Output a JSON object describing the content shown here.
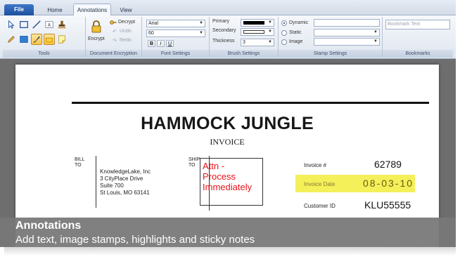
{
  "ribbon": {
    "tabs": [
      "File",
      "Home",
      "Annotations",
      "View"
    ],
    "groups": [
      "Tools",
      "Document Encryption",
      "Font Settings",
      "Brush Settings",
      "Stamp Settings",
      "Bookmarks"
    ],
    "encryption": {
      "encrypt": "Encrypt",
      "decrypt": "Decrypt",
      "undo": "Undo",
      "redo": "Redo"
    },
    "font": {
      "family": "Arial",
      "size": "60",
      "bold": "B",
      "italic": "I",
      "underline": "U"
    },
    "brush": {
      "primary": "Primary",
      "secondary": "Secondary",
      "thickness": "Thickness",
      "thickness_value": "3",
      "primary_color": "#000000",
      "secondary_color": "#ffffff"
    },
    "stamp": {
      "dynamic": "Dynamic",
      "static": "Static",
      "image": "Image"
    },
    "bookmarks": {
      "placeholder": "Bookmark Text"
    }
  },
  "document": {
    "title": "HAMMOCK JUNGLE",
    "subtitle": "INVOICE",
    "bill_to_1": "BILL",
    "bill_to_2": "TO",
    "ship_to_1": "SHIP",
    "ship_to_2": "TO",
    "address": [
      "KnowledgeLake, Inc",
      "3 CityPlace Drive",
      "Suite 700",
      "St Louis, MO 63141"
    ],
    "stamp_lines": [
      "Attn -",
      "Process",
      "Immediately"
    ],
    "invoice_number_label": "Invoice #",
    "invoice_number": "62789",
    "invoice_date_label": "Invoice Date",
    "invoice_date": "08-03-10",
    "customer_id_label": "Customer ID",
    "customer_id": "KLU55555",
    "highlight_color": "#f3f05a",
    "stamp_color": "#e8131b"
  },
  "caption": {
    "title": "Annotations",
    "description": "Add text, image stamps, highlights and sticky notes"
  }
}
